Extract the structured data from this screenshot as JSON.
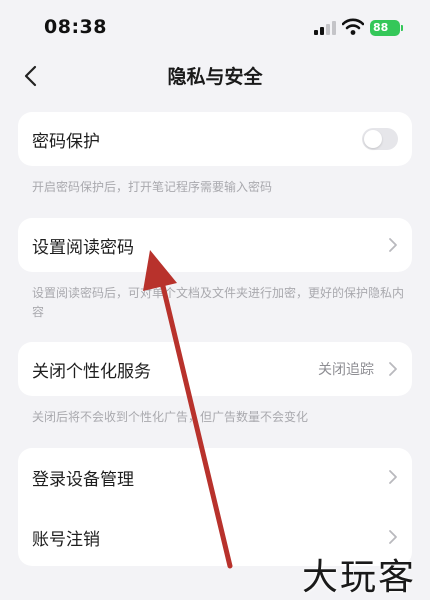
{
  "status_bar": {
    "time": "08:38",
    "battery": "88"
  },
  "nav": {
    "title": "隐私与安全"
  },
  "password_protect": {
    "label": "密码保护",
    "enabled": false,
    "hint": "开启密码保护后，打开笔记程序需要输入密码"
  },
  "read_password": {
    "label": "设置阅读密码",
    "hint": "设置阅读密码后，可对单个文档及文件夹进行加密，更好的保护隐私内容"
  },
  "personalization": {
    "label": "关闭个性化服务",
    "value": "关闭追踪",
    "hint": "关闭后将不会收到个性化广告，但广告数量不会变化"
  },
  "account": {
    "devices_label": "登录设备管理",
    "delete_label": "账号注销"
  },
  "watermark": "大玩客",
  "colors": {
    "background": "#f3f3f6",
    "card": "#ffffff",
    "arrow": "#b8322c",
    "battery": "#34c759"
  }
}
